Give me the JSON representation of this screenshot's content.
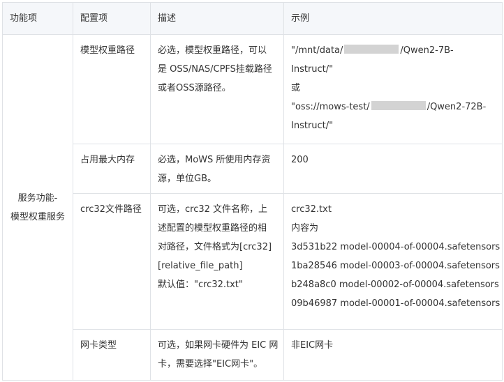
{
  "headers": [
    "功能项",
    "配置项",
    "描述",
    "示例"
  ],
  "feature_line1": "服务功能-",
  "feature_line2": "模型权重服务",
  "rows": [
    {
      "item": "模型权重路径",
      "desc_lines": [
        "必选，模型权重路径，可以",
        "是 OSS/NAS/CPFS挂载路径",
        "或者OSS源路径。"
      ],
      "example": {
        "p1_prefix": "\"/mnt/data/",
        "p1_suffix": "/Qwen2-7B-",
        "p1_line2": "Instruct/\"",
        "or": "或",
        "p2_prefix": "\"oss://mows-test/",
        "p2_suffix": "/Qwen2-72B-",
        "p2_line2": "Instruct/\""
      }
    },
    {
      "item": "占用最大内存",
      "desc_lines": [
        "必选，MoWS 所使用内存资",
        "源，单位GB。"
      ],
      "example_lines": [
        "200"
      ]
    },
    {
      "item": "crc32文件路径",
      "desc_lines": [
        "可选，crc32 文件名称，上",
        "述配置的模型权重路径的相",
        "对路径，文件格式为[crc32]",
        "[relative_file_path]",
        "默认值：\"crc32.txt\""
      ],
      "example_lines": [
        "crc32.txt",
        "内容为",
        "3d531b22 model-00004-of-00004.safetensors",
        "1ba28546 model-00003-of-00004.safetensors",
        "b248a8c0 model-00002-of-00004.safetensors",
        "09b46987 model-00001-of-00004.safetensors"
      ]
    },
    {
      "item": "网卡类型",
      "desc_lines": [
        "可选，如果网卡硬件为 EIC 网",
        "卡，需要选择\"EIC网卡\"。"
      ],
      "example_lines": [
        "非EIC网卡"
      ]
    }
  ]
}
